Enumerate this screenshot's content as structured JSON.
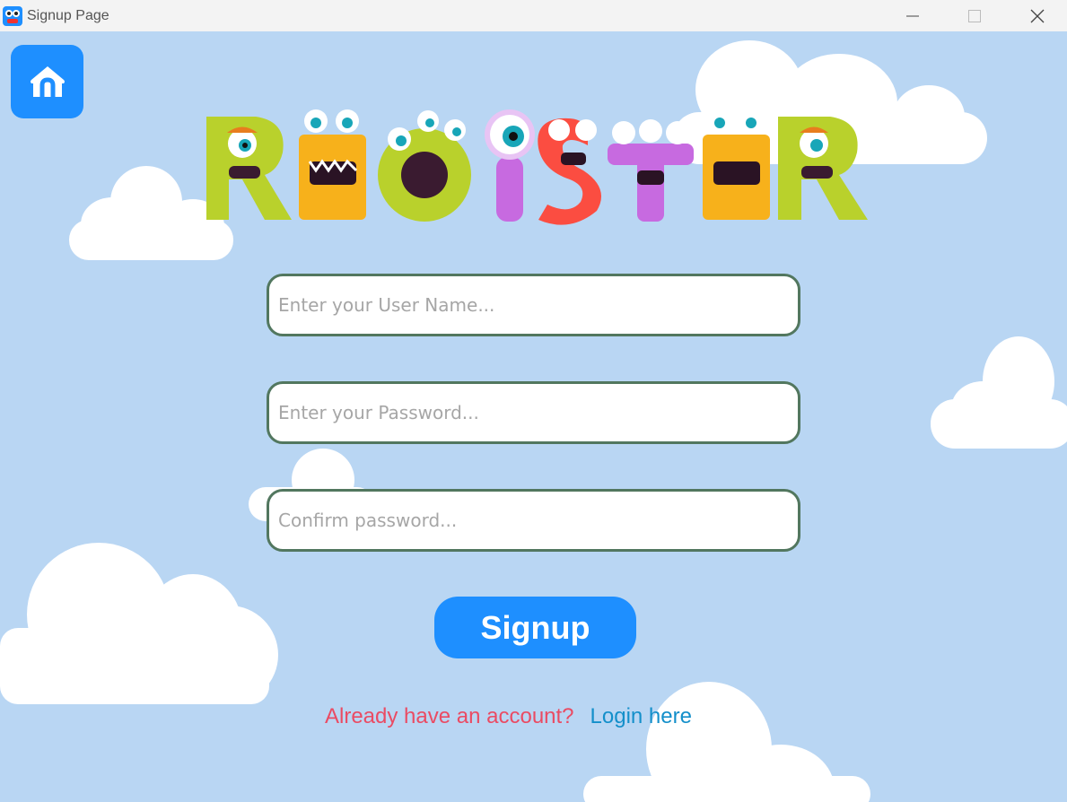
{
  "window": {
    "title": "Signup Page"
  },
  "header": {
    "title": "REGISTER",
    "home_icon": "home-icon"
  },
  "form": {
    "username_placeholder": "Enter your User Name...",
    "password_placeholder": "Enter your Password...",
    "confirm_placeholder": "Confirm password...",
    "username_value": "",
    "password_value": "",
    "confirm_value": "",
    "signup_label": "Signup"
  },
  "footer": {
    "prompt": "Already have an account?",
    "login_label": "Login here"
  },
  "colors": {
    "background": "#b9d6f3",
    "accent": "#1e8fff",
    "field_border": "#52775f",
    "prompt": "#ea4b63",
    "link": "#138fca"
  }
}
